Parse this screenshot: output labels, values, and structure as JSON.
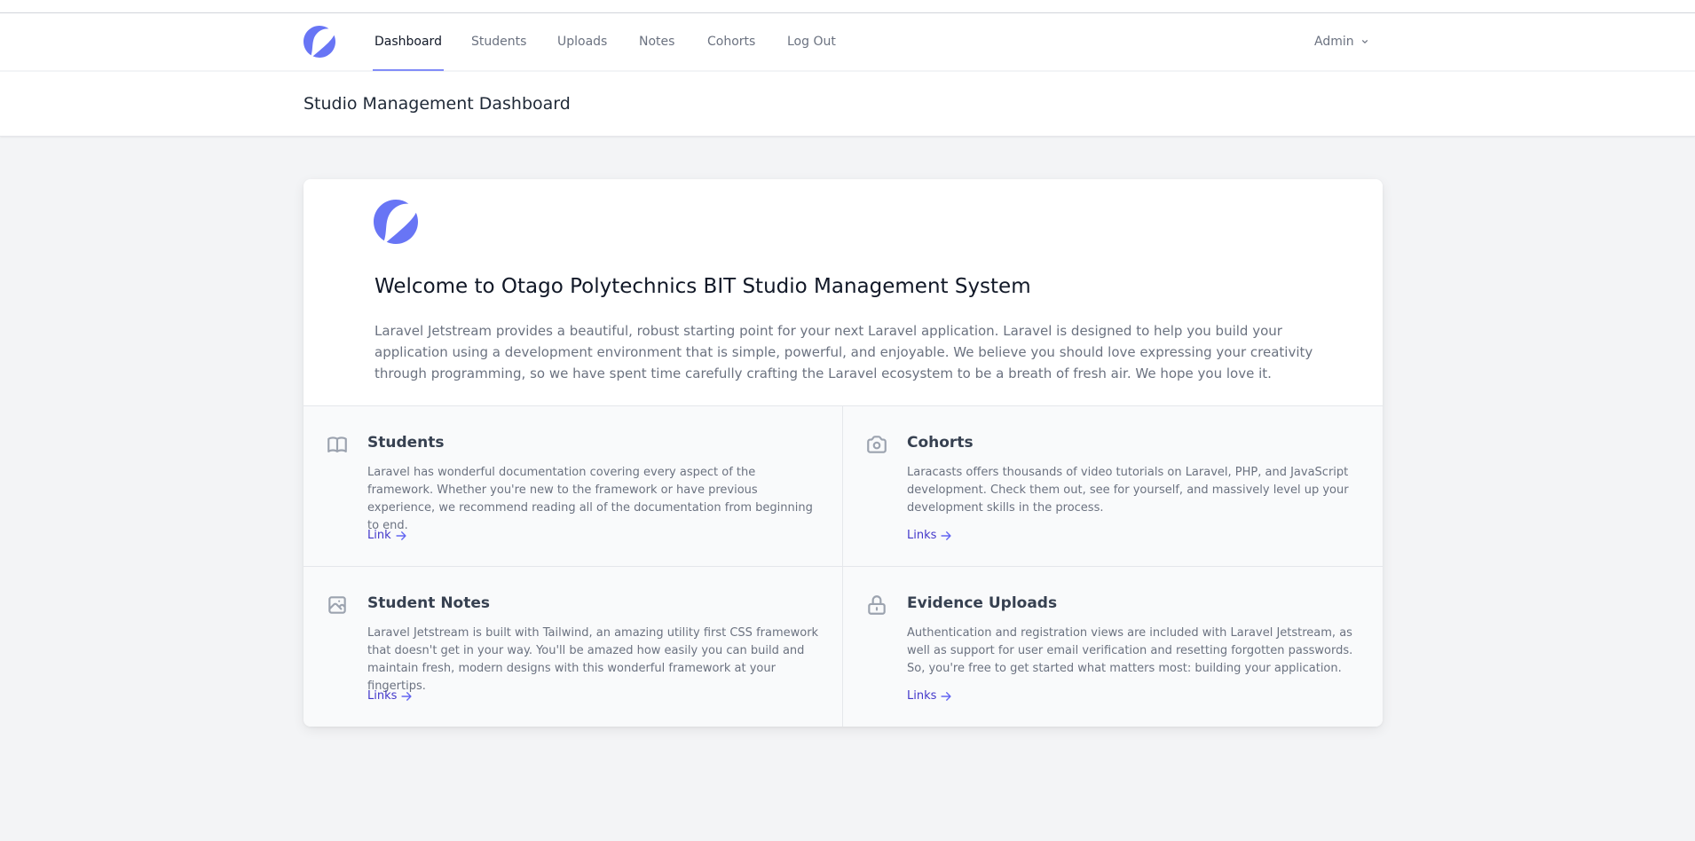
{
  "nav": {
    "items": [
      {
        "label": "Dashboard",
        "active": true
      },
      {
        "label": "Students",
        "active": false
      },
      {
        "label": "Uploads",
        "active": false
      },
      {
        "label": "Notes",
        "active": false
      },
      {
        "label": "Cohorts",
        "active": false
      },
      {
        "label": "Log Out",
        "active": false
      }
    ],
    "user": "Admin",
    "logo_icon": "jetstream-logo-icon"
  },
  "header": {
    "title": "Studio Management Dashboard"
  },
  "welcome": {
    "logo_icon": "jetstream-logo-icon",
    "title": "Welcome to Otago Polytechnics BIT Studio Management System",
    "text": "Laravel Jetstream provides a beautiful, robust starting point for your next Laravel application. Laravel is designed to help you build your application using a development environment that is simple, powerful, and enjoyable. We believe you should love expressing your creativity through programming, so we have spent time carefully crafting the Laravel ecosystem to be a breath of fresh air. We hope you love it."
  },
  "features": [
    {
      "icon": "book-icon",
      "title": "Students",
      "description": "Laravel has wonderful documentation covering every aspect of the framework. Whether you're new to the framework or have previous experience, we recommend reading all of the documentation from beginning to end.",
      "link": "Link"
    },
    {
      "icon": "camera-icon",
      "title": "Cohorts",
      "description": "Laracasts offers thousands of video tutorials on Laravel, PHP, and JavaScript development. Check them out, see for yourself, and massively level up your development skills in the process.",
      "link": "Links"
    },
    {
      "icon": "image-icon",
      "title": "Student Notes",
      "description": "Laravel Jetstream is built with Tailwind, an amazing utility first CSS framework that doesn't get in your way. You'll be amazed how easily you can build and maintain fresh, modern designs with this wonderful framework at your fingertips.",
      "link": "Links"
    },
    {
      "icon": "lock-icon",
      "title": "Evidence Uploads",
      "description": "Authentication and registration views are included with Laravel Jetstream, as well as support for user email verification and resetting forgotten passwords. So, you're free to get started what matters most: building your application.",
      "link": "Links"
    }
  ],
  "colors": {
    "accent": "#6875f5",
    "active_underline": "#818cf8",
    "link": "#4338ca",
    "background": "#f3f4f6"
  }
}
